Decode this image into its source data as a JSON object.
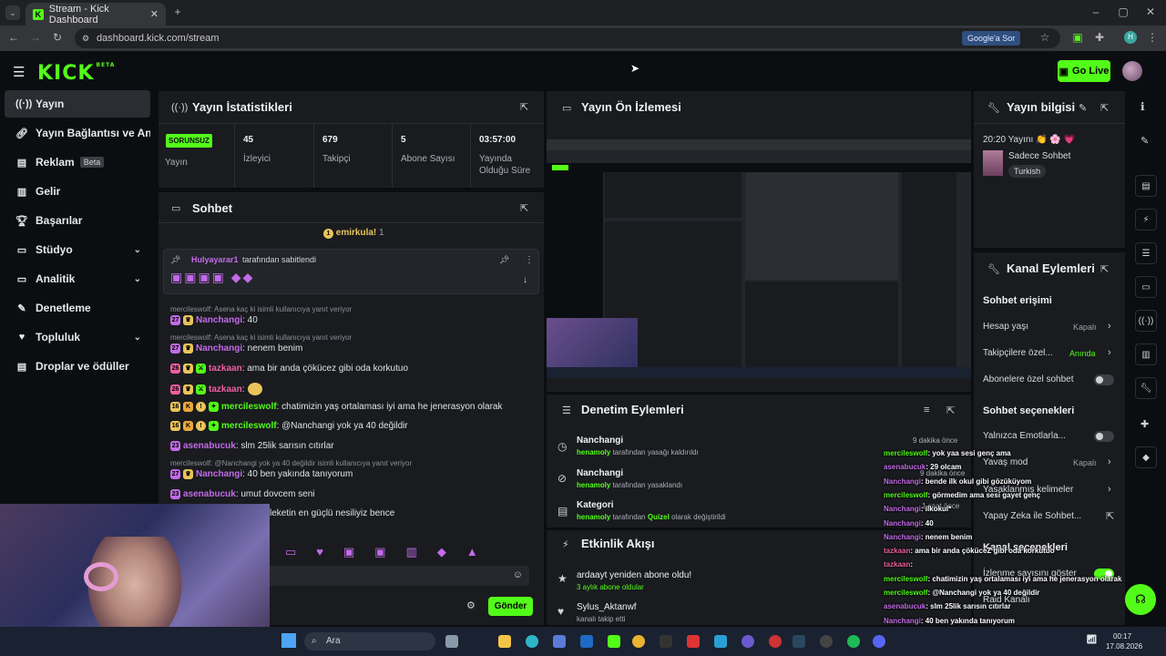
{
  "browser": {
    "tab_title": "Stream - Kick Dashboard",
    "url": "dashboard.kick.com/stream",
    "ask_google": "Google'a Sor"
  },
  "header": {
    "logo": "KICK",
    "logo_beta": "BETA",
    "go_live": "Go Live"
  },
  "sidebar": {
    "items": [
      {
        "label": "Yayın",
        "icon": "broadcast-icon"
      },
      {
        "label": "Yayın Bağlantısı ve Anahtarı",
        "icon": "link-icon"
      },
      {
        "label": "Reklam",
        "badge": "Beta",
        "icon": "ad-icon"
      },
      {
        "label": "Gelir",
        "icon": "revenue-icon"
      },
      {
        "label": "Başarılar",
        "icon": "trophy-icon"
      },
      {
        "label": "Stüdyo",
        "icon": "studio-icon"
      },
      {
        "label": "Analitik",
        "icon": "analytics-icon"
      },
      {
        "label": "Denetleme",
        "icon": "moderation-icon"
      },
      {
        "label": "Topluluk",
        "icon": "community-icon"
      },
      {
        "label": "Droplar ve ödüller",
        "icon": "drops-icon"
      }
    ]
  },
  "stats": {
    "title": "Yayın İstatistikleri",
    "status_badge": "SORUNSUZ",
    "status_label": "Yayın",
    "viewers": "45",
    "viewers_label": "İzleyici",
    "followers": "679",
    "followers_label": "Takipçi",
    "subs": "5",
    "subs_label": "Abone Sayısı",
    "uptime": "03:57:00",
    "uptime_label_1": "Yayında",
    "uptime_label_2": "Olduğu Süre"
  },
  "chat": {
    "title": "Sohbet",
    "top_gifter": "emirkula!",
    "top_gifter_count": "1",
    "pinned_user": "Hulyayarar1",
    "pinned_suffix": "tarafından sabitlendi",
    "messages": [
      {
        "reply": "mercileswolf: Asena kaç ki isimli kullanıcıya yanıt veriyor",
        "user": "Nanchangi",
        "text": ": 40",
        "color": "purple"
      },
      {
        "reply": "mercileswolf: Asena kaç ki isimli kullanıcıya yanıt veriyor",
        "user": "Nanchangi",
        "text": ": nenem benim",
        "color": "purple"
      },
      {
        "user": "tazkaan",
        "text": ": ama bir anda çökücez gibi oda korkutuo",
        "color": "pink"
      },
      {
        "user": "tazkaan",
        "text": ":",
        "color": "pink"
      },
      {
        "user": "mercileswolf",
        "text": ": chatimizin yaş ortalaması iyi ama he jenerasyon olarak",
        "color": "green"
      },
      {
        "user": "mercileswolf",
        "text": ": @Nanchangi yok ya 40 değildir",
        "color": "green"
      },
      {
        "user": "asenabucuk",
        "text": ": slm 25lik sarısın cıtırlar",
        "color": "purple"
      },
      {
        "reply": "mercileswolf: @Nanchangi yok ya 40 değildir isimli kullanıcıya yanıt veriyor",
        "user": "Nanchangi",
        "text": ": 40 ben yakında tanıyorum",
        "color": "purple"
      },
      {
        "user": "asenabucuk",
        "text": ": umut dovcem seni",
        "color": "purple"
      },
      {
        "user": "",
        "text": "leketin en güçlü nesiliyiz bence",
        "color": "purple"
      }
    ],
    "send": "Gönder"
  },
  "preview": {
    "title": "Yayın Ön İzlemesi"
  },
  "moderation": {
    "title": "Denetim Eylemleri",
    "rows": [
      {
        "user": "Nanchangi",
        "mod": "henamoly",
        "action": "tarafından yasağı kaldırıldı",
        "time": "9 dakika önce"
      },
      {
        "user": "Nanchangi",
        "mod": "henamoly",
        "action": "tarafından yasaklandı",
        "time": "9 dakika önce"
      },
      {
        "user": "Kategori",
        "mod": "henamoly",
        "action": "tarafından",
        "extra": "Quizel",
        "action2": "olarak değiştirildi",
        "time": "1 saat önce"
      }
    ]
  },
  "activity": {
    "title": "Etkinlik Akışı",
    "rows": [
      {
        "text": "ardaayt yeniden abone oldu!",
        "sub": "3 aylık abone oldular"
      },
      {
        "text": "Sylus_Aktanwf",
        "sub": "kanalı takip etti"
      }
    ]
  },
  "stream_info": {
    "title": "Yayın bilgisi",
    "stream_title": "20:20 Yayını 👏 🌸 💗",
    "category": "Sadece Sohbet",
    "language": "Turkish"
  },
  "channel_actions": {
    "title": "Kanal Eylemleri",
    "chat_access": "Sohbet erişimi",
    "account_age": "Hesap yaşı",
    "account_age_val": "Kapalı",
    "followers_only": "Takipçilere özel...",
    "followers_only_val": "Anında",
    "subs_only": "Abonelere özel sohbet",
    "chat_options": "Sohbet seçenekleri",
    "emotes_only": "Yalnızca Emotlarla...",
    "slow_mode": "Yavaş mod",
    "slow_mode_val": "Kapalı",
    "banned_words": "Yasaklanmış kelimeler",
    "ai_chat": "Yapay Zeka ile Sohbet...",
    "channel_options": "Kanal seçenekleri",
    "show_viewers": "İzlenme sayısını göster",
    "raid": "Raid Kanalı"
  },
  "overlay_chat": [
    {
      "user": "mercileswolf",
      "text": ": yok yaa sesi genç ama",
      "color": "#53fc18"
    },
    {
      "user": "asenabucuk",
      "text": ": 29 olcam",
      "color": "#c26be8"
    },
    {
      "user": "Nanchangi",
      "text": ": bende ilk okul gibi gözüküyom",
      "color": "#c26be8"
    },
    {
      "user": "mercileswolf",
      "text": ": görmedim ama sesi gayet genç",
      "color": "#53fc18"
    },
    {
      "user": "Nanchangi",
      "text": ": ilkokul*",
      "color": "#c26be8"
    },
    {
      "user": "Nanchangi",
      "text": ": 40",
      "color": "#c26be8"
    },
    {
      "user": "Nanchangi",
      "text": ": nenem benim",
      "color": "#c26be8"
    },
    {
      "user": "tazkaan",
      "text": ": ama bir anda çöküceZ gibi oda korkutuo",
      "color": "#ee5fa0"
    },
    {
      "user": "tazkaan",
      "text": ":",
      "color": "#ee5fa0"
    },
    {
      "user": "mercileswolf",
      "text": ": chatimizin yaş ortalaması iyi ama he jenerasyon olarak",
      "color": "#53fc18"
    },
    {
      "user": "mercileswolf",
      "text": ": @Nanchangi yok ya 40 değildir",
      "color": "#53fc18"
    },
    {
      "user": "asenabucuk",
      "text": ": slm 25lik sarısın cıtırlar",
      "color": "#c26be8"
    },
    {
      "user": "Nanchangi",
      "text": ": 40 ben yakında tanıyorum",
      "color": "#c26be8"
    },
    {
      "user": "asenabucuk",
      "text": ": umut dovcem seni",
      "color": "#c26be8"
    },
    {
      "user": "tazkaan",
      "text": ": memleketin en güçlü nesiliyiz bence",
      "color": "#ee5fa0"
    }
  ],
  "taskbar": {
    "search": "Ara",
    "time": "00:17",
    "date": "17.08.2026"
  }
}
